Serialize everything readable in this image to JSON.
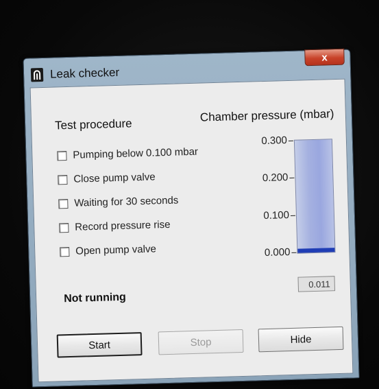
{
  "window": {
    "title": "Leak checker",
    "close_label": "x"
  },
  "procedure": {
    "title": "Test procedure",
    "steps": [
      {
        "label": "Pumping below 0.100 mbar",
        "checked": false
      },
      {
        "label": "Close pump valve",
        "checked": false
      },
      {
        "label": "Waiting for 30 seconds",
        "checked": false
      },
      {
        "label": "Record pressure rise",
        "checked": false
      },
      {
        "label": "Open pump valve",
        "checked": false
      }
    ]
  },
  "gauge": {
    "title": "Chamber pressure (mbar)",
    "ticks": [
      "0.300",
      "0.200",
      "0.100",
      "0.000"
    ],
    "min": 0,
    "max": 0.3,
    "value": 0.011,
    "value_text": "0.011",
    "fill_color": "#1f3db5"
  },
  "status": {
    "text": "Not running"
  },
  "buttons": {
    "start": "Start",
    "stop": "Stop",
    "hide": "Hide"
  }
}
